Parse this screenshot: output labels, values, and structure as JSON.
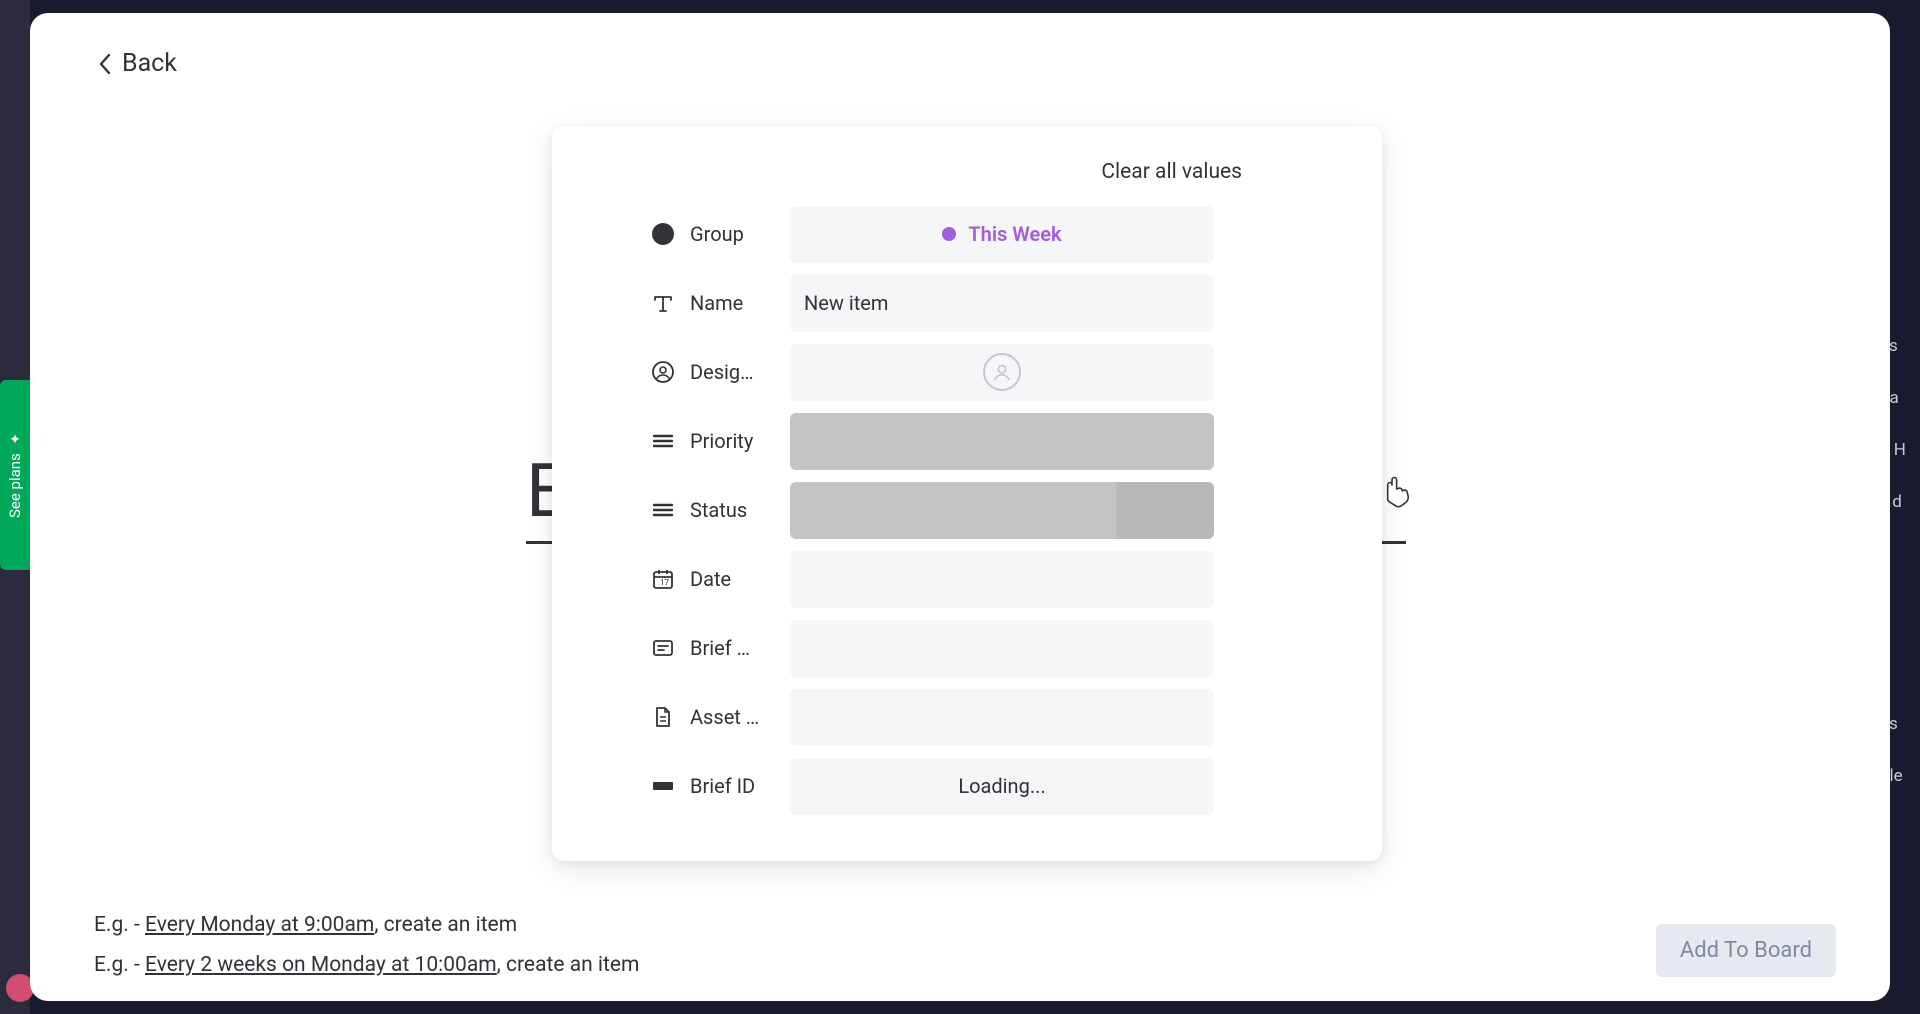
{
  "back_label": "Back",
  "see_plans_label": "See plans",
  "peek_title_char": "E",
  "clear_all_label": "Clear all values",
  "fields": {
    "group": {
      "label": "Group",
      "value": "This Week"
    },
    "name": {
      "label": "Name",
      "value": "New item"
    },
    "designer": {
      "label": "Desig…"
    },
    "priority": {
      "label": "Priority"
    },
    "status": {
      "label": "Status"
    },
    "date": {
      "label": "Date"
    },
    "brief_link": {
      "label": "Brief …"
    },
    "asset": {
      "label": "Asset …"
    },
    "brief_id": {
      "label": "Brief ID",
      "value": "Loading..."
    }
  },
  "examples": {
    "prefix": "E.g. - ",
    "ex1_underline": "Every Monday at 9:00am",
    "ex1_rest": ", create an item",
    "ex2_underline": "Every 2 weeks on Monday at 10:00am",
    "ex2_rest": ", create an item"
  },
  "add_button_label": "Add To Board",
  "bg_right_lines": [
    "es",
    "ba",
    "d H",
    "y d",
    "es",
    "ble"
  ]
}
